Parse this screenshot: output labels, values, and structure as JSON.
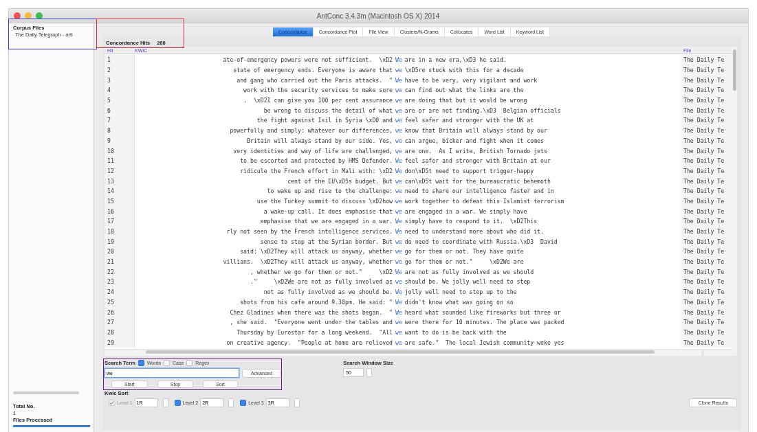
{
  "window": {
    "title": "AntConc 3.4.3m (Macintosh OS X) 2014"
  },
  "sidebar": {
    "heading": "Corpus Files",
    "files": [
      {
        "name": "The Daily Telegraph - arti",
        "selected": false
      }
    ],
    "total_label": "Total No.",
    "total_value": "1",
    "processed_label": "Files Processed",
    "progress": {
      "level": 1
    }
  },
  "tabs": [
    {
      "label": "Concordance",
      "selected": true
    },
    {
      "label": "Concordance Plot",
      "selected": false
    },
    {
      "label": "File View",
      "selected": false
    },
    {
      "label": "Clusters/N-Grams",
      "selected": false
    },
    {
      "label": "Collocates",
      "selected": false
    },
    {
      "label": "Word List",
      "selected": false
    },
    {
      "label": "Keyword List",
      "selected": false
    }
  ],
  "hits": {
    "label": "Concordance Hits",
    "value": "266"
  },
  "table": {
    "columns": [
      "Hit",
      "KWIC",
      "File"
    ],
    "rows": [
      {
        "hit": "1",
        "left": "ate-of-emergency powers were not sufficient.  \\xD2",
        "keyword": "We",
        "right": "are in a new era,\\xD3 he said.",
        "file": "The Daily Te"
      },
      {
        "hit": "2",
        "left": "state of emergency ends. Everyone is aware that",
        "keyword": "we",
        "right": "\\xD5re stuck with this for a decade",
        "file": "The Daily Te"
      },
      {
        "hit": "3",
        "left": "and gang who carried out the Paris attacks.  \"",
        "keyword": "We",
        "right": "have to be very, very vigilant and work",
        "file": "The Daily Te"
      },
      {
        "hit": "4",
        "left": "work with the security services to make sure",
        "keyword": "we",
        "right": "can find out what the links are the",
        "file": "The Daily Te"
      },
      {
        "hit": "5",
        "left": ".  \\xD2I can give you 100 per cent assurance",
        "keyword": "we",
        "right": "are doing that but it would be wrong",
        "file": "The Daily Te"
      },
      {
        "hit": "6",
        "left": "be wrong to discuss the detail of what",
        "keyword": "we",
        "right": "are or are not finding.\\xD3  Belgian officials",
        "file": "The Daily Te"
      },
      {
        "hit": "7",
        "left": "the fight against Isil in Syria \\xD0 and",
        "keyword": "we",
        "right": "feel safer and stronger with the UK at",
        "file": "The Daily Te"
      },
      {
        "hit": "8",
        "left": "powerfully and simply: whatever our differences,",
        "keyword": "we",
        "right": "know that Britain will always stand by our",
        "file": "The Daily Te"
      },
      {
        "hit": "9",
        "left": "Britain will always stand by our side. Yes,",
        "keyword": "we",
        "right": "can argue, bicker and fight when it comes",
        "file": "The Daily Te"
      },
      {
        "hit": "10",
        "left": "very identities and way of life are challenged,",
        "keyword": "we",
        "right": "are one.  As I write, British Tornado jets",
        "file": "The Daily Te"
      },
      {
        "hit": "11",
        "left": "to be escorted and protected by HMS Defender.",
        "keyword": "We",
        "right": "feel safer and stronger with Britain at our",
        "file": "The Daily Te"
      },
      {
        "hit": "12",
        "left": "ridicule the French effort in Mali with: \\xD2",
        "keyword": "We",
        "right": "don\\xD5t need to support trigger-happy",
        "file": "The Daily Te"
      },
      {
        "hit": "13",
        "left": "cent of the EU\\xD5s budget. But",
        "keyword": "we",
        "right": "can\\xD5t wait for the bureaucratic behemoth",
        "file": "The Daily Te"
      },
      {
        "hit": "14",
        "left": "to wake up and rise to the challenge:",
        "keyword": "we",
        "right": "need to share our intelligence faster and in",
        "file": "The Daily Te"
      },
      {
        "hit": "15",
        "left": "use the Turkey summit to discuss \\xD2how",
        "keyword": "we",
        "right": "work together to defeat this Islamist terrorism",
        "file": "The Daily Te"
      },
      {
        "hit": "16",
        "left": "a wake-up call. It does emphasise that",
        "keyword": "we",
        "right": "are engaged in a war. We simply have",
        "file": "The Daily Te"
      },
      {
        "hit": "17",
        "left": "emphasise that we are engaged in a war.",
        "keyword": "We",
        "right": "simply have to respond to it.  \\xD2This",
        "file": "The Daily Te"
      },
      {
        "hit": "18",
        "left": "rly not seen by the French intelligence services.",
        "keyword": "We",
        "right": "need to understand more about who did it.",
        "file": "The Daily Te"
      },
      {
        "hit": "19",
        "left": "sense to stop at the Syrian border. But",
        "keyword": "we",
        "right": "do need to coordinate with Russia.\\xD3  David",
        "file": "The Daily Te"
      },
      {
        "hit": "20",
        "left": "said: \\xD2They will attack us anyway, whether",
        "keyword": "we",
        "right": "go for them or not. They have quite",
        "file": "The Daily Te"
      },
      {
        "hit": "21",
        "left": "villians.  \\xD2They will attack us anyway, whether",
        "keyword": "we",
        "right": "go for them or not.\"     \\xD2We are",
        "file": "The Daily Te"
      },
      {
        "hit": "22",
        "left": ", whether we go for them or not.\"     \\xD2",
        "keyword": "We",
        "right": "are not as fully involved as we should",
        "file": "The Daily Te"
      },
      {
        "hit": "23",
        "left": ".\"     \\xD2We are not as fully involved as",
        "keyword": "we",
        "right": "should be. We jolly well need to step",
        "file": "The Daily Te"
      },
      {
        "hit": "24",
        "left": "not as fully involved as we should be.",
        "keyword": "We",
        "right": "jolly well need to step up to the",
        "file": "The Daily Te"
      },
      {
        "hit": "25",
        "left": "shots from his cafe around 9.30pm. He said: \"",
        "keyword": "We",
        "right": "didn't know what was going on so",
        "file": "The Daily Te"
      },
      {
        "hit": "26",
        "left": "Chez Gladines when there was the shots began.  \"",
        "keyword": "We",
        "right": "heard what sounded like fireworks but three or",
        "file": "The Daily Te"
      },
      {
        "hit": "27",
        "left": ", she said.  \"Everyone went under the tables and",
        "keyword": "we",
        "right": "were there for 10 minutes. The place was packed",
        "file": "The Daily Te"
      },
      {
        "hit": "28",
        "left": "Thursday by Eurostar for a long weekend.  \"All",
        "keyword": "we",
        "right": "want to do is be back with the",
        "file": "The Daily Te"
      },
      {
        "hit": "29",
        "left": "on creative agency.  \"People at home are relieved",
        "keyword": "we",
        "right": "are safe.\"  The local Jewish community woke yes",
        "file": "The Daily Te"
      }
    ]
  },
  "search": {
    "label": "Search Term",
    "options": [
      {
        "label": "Words",
        "checked": true
      },
      {
        "label": "Case",
        "checked": false
      },
      {
        "label": "Regex",
        "checked": false
      }
    ],
    "value": "we",
    "advanced": "Advanced",
    "window_label": "Search Window Size",
    "window_value": "50"
  },
  "actions": [
    "Start",
    "Stop",
    "Sort"
  ],
  "kwic_sort": {
    "label": "Kwic Sort",
    "levels": [
      {
        "label": "Level 1",
        "value": "1R",
        "checked": true,
        "disabled": true
      },
      {
        "label": "Level 2",
        "value": "2R",
        "checked": true,
        "disabled": false
      },
      {
        "label": "Level 3",
        "value": "3R",
        "checked": true,
        "disabled": false
      }
    ]
  },
  "clone": "Clone Results",
  "annotations": [
    {
      "color": "#3b3bd0"
    },
    {
      "color": "#e0283a"
    },
    {
      "color": "#6a1a80"
    }
  ]
}
